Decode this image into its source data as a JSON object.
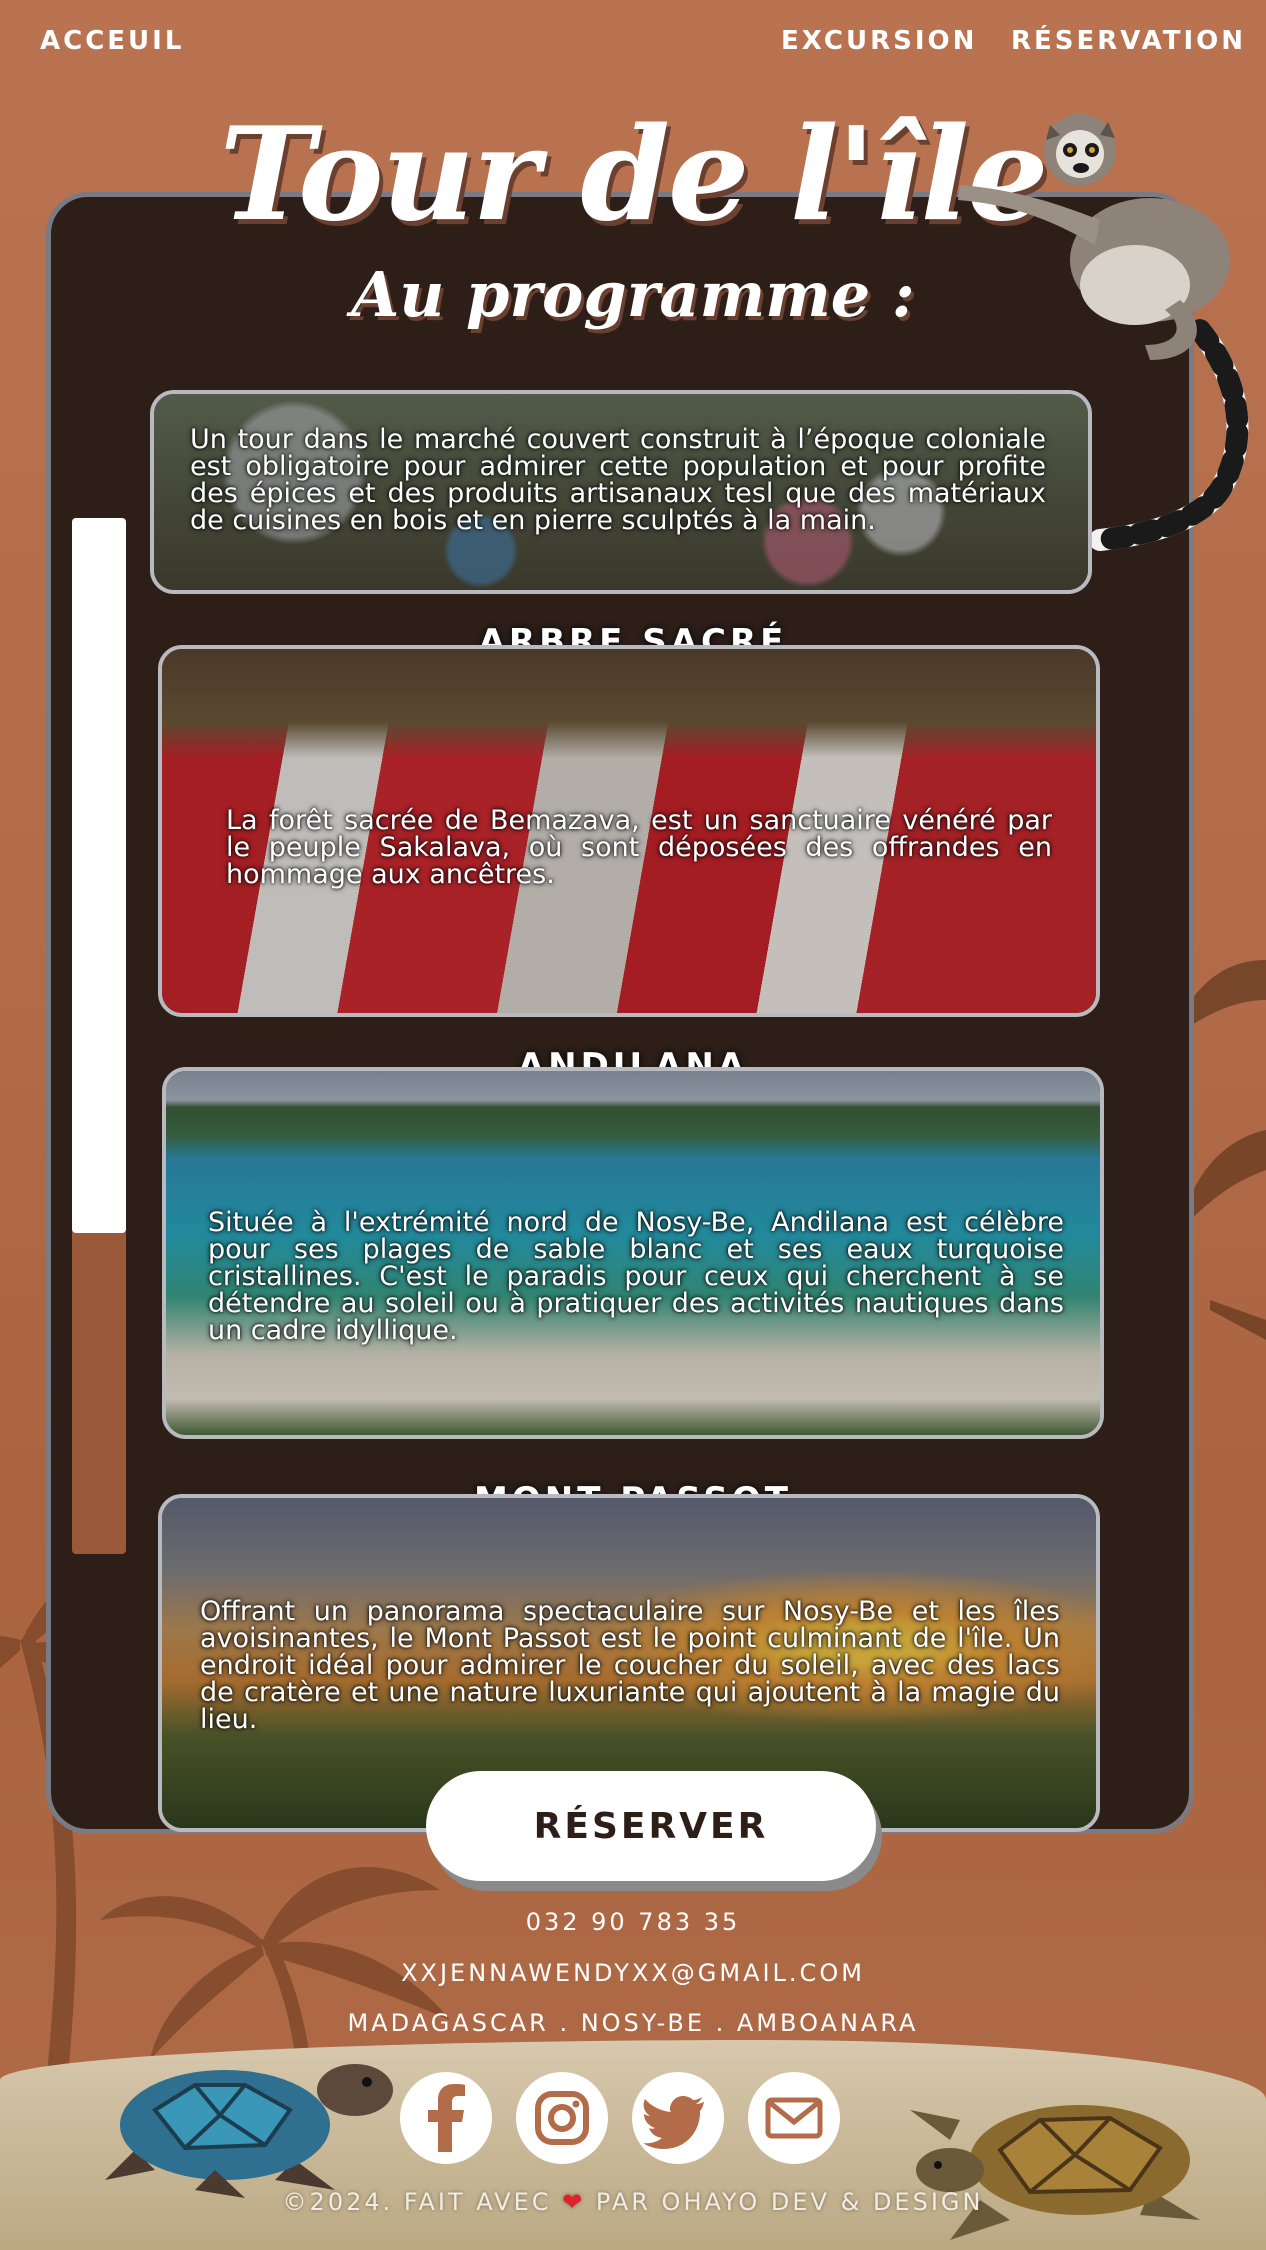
{
  "nav": {
    "home": "ACCEUIL",
    "excursion": "EXCURSION",
    "reservation": "RÉSERVATION"
  },
  "header": {
    "title": "Tour de l'île",
    "subtitle": "Au programme :"
  },
  "scrollbar": {
    "thumb_fraction": 0.69
  },
  "cards": [
    {
      "title": "",
      "text": "Un tour dans le marché couvert construit à l’époque coloniale est obligatoire pour admirer cette population et pour profite des épices et des produits artisanaux tesl que des  matériaux de cuisines en bois et en pierre sculptés à la main."
    },
    {
      "title": "ARBRE SACRÉ",
      "text": "La forêt sacrée de Bemazava, est un sanctuaire vénéré par le peuple Sakalava, où sont déposées des offrandes en hommage aux ancêtres."
    },
    {
      "title": "ANDILANA",
      "text": "Située à l'extrémité nord de Nosy-Be, Andilana est célèbre pour ses plages de sable blanc et ses eaux turquoise cristallines. C'est le paradis pour ceux qui cherchent à se détendre au soleil ou à pratiquer des activités nautiques dans un cadre idyllique."
    },
    {
      "title": "MONT PASSOT",
      "text": "Offrant un panorama spectaculaire sur Nosy-Be et les îles avoisinantes, le Mont Passot est le point culminant de l'île. Un endroit idéal pour admirer le coucher du soleil, avec des lacs de cratère et une nature luxuriante qui ajoutent à la magie du lieu."
    }
  ],
  "cta": {
    "label": "RÉSERVER"
  },
  "footer": {
    "phone": "032 90 783 35",
    "email": "XXJENNAWENDYXX@GMAIL.COM",
    "location": "MADAGASCAR . NOSY-BE . AMBOANARA",
    "copyright_prefix": "©2024. FAIT AVEC",
    "heart": "❤",
    "copyright_suffix": "PAR OHAYO DEV & DESIGN"
  },
  "social": [
    "facebook-icon",
    "instagram-icon",
    "twitter-icon",
    "mail-icon"
  ],
  "colors": {
    "background": "#b26c4a",
    "panel": "#2d1f18",
    "panel_border": "#7a7a84",
    "accent_heart": "#e0202a",
    "text": "#ffffff"
  }
}
